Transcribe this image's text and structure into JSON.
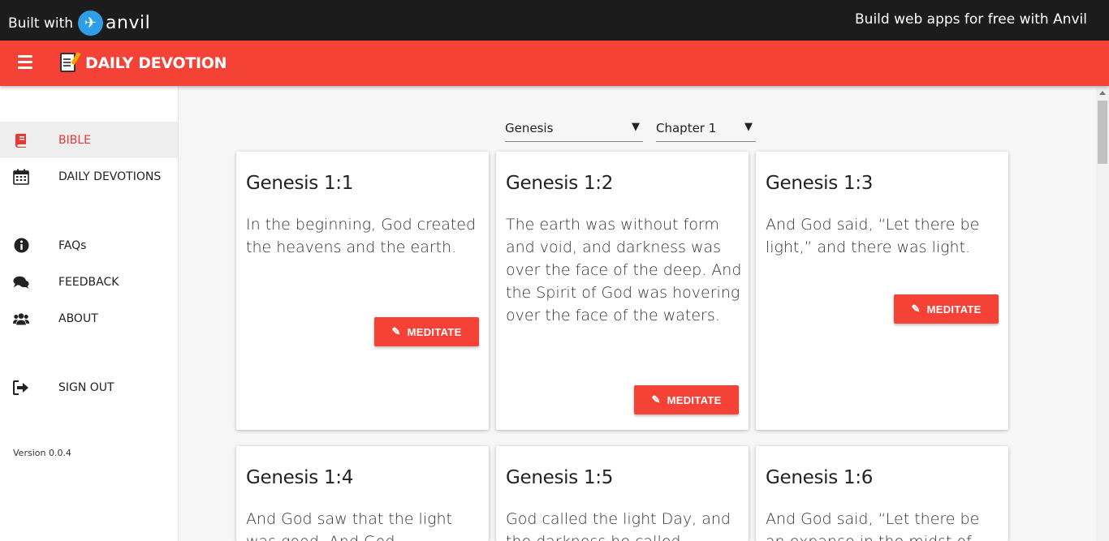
{
  "topbar": {
    "built_with": "Built with",
    "brand": "anvil",
    "build_free": "Build web apps for free with Anvil"
  },
  "header": {
    "title": "DAILY DEVOTION",
    "menu_icon": "hamburger-icon",
    "app_icon": "memo-icon"
  },
  "colors": {
    "accent": "#f44336",
    "topbar": "#1c1c1c",
    "anvil_blue": "#2e9fe6"
  },
  "sidebar": {
    "items": [
      {
        "label": "BIBLE",
        "icon": "book-icon",
        "active": true
      },
      {
        "label": "DAILY DEVOTIONS",
        "icon": "calendar-icon",
        "active": false
      },
      {
        "label": "FAQs",
        "icon": "info-circle-icon",
        "active": false
      },
      {
        "label": "FEEDBACK",
        "icon": "comments-icon",
        "active": false
      },
      {
        "label": "ABOUT",
        "icon": "users-icon",
        "active": false
      },
      {
        "label": "SIGN OUT",
        "icon": "sign-out-icon",
        "active": false
      }
    ],
    "version": "Version 0.0.4"
  },
  "filters": {
    "book": "Genesis",
    "chapter": "Chapter 1"
  },
  "button_label": "MEDITATE",
  "verses": [
    {
      "ref": "Genesis 1:1",
      "text": "In the beginning, God created the heavens and the earth."
    },
    {
      "ref": "Genesis 1:2",
      "text": "The earth was without form and void, and darkness was over the face of the deep. And the Spirit of God was hovering over the face of the waters."
    },
    {
      "ref": "Genesis 1:3",
      "text": "And God said, “Let there be light,” and there was light."
    },
    {
      "ref": "Genesis 1:4",
      "text": "And God saw that the light was good. And God"
    },
    {
      "ref": "Genesis 1:5",
      "text": "God called the light Day, and the darkness he called"
    },
    {
      "ref": "Genesis 1:6",
      "text": "And God said, “Let there be an expanse in the midst of"
    }
  ]
}
